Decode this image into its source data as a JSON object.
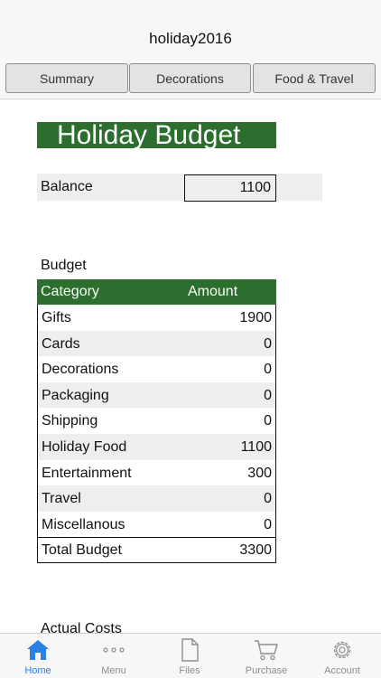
{
  "app": {
    "title": "holiday2016"
  },
  "tabs": [
    {
      "label": "Summary"
    },
    {
      "label": "Decorations"
    },
    {
      "label": "Food & Travel"
    }
  ],
  "sheet": {
    "title": "Holiday Budget",
    "balance": {
      "label": "Balance",
      "value": "1100"
    },
    "budget": {
      "section_label": "Budget",
      "headers": {
        "category": "Category",
        "amount": "Amount"
      },
      "rows": [
        {
          "category": "Gifts",
          "amount": "1900"
        },
        {
          "category": "Cards",
          "amount": "0"
        },
        {
          "category": "Decorations",
          "amount": "0"
        },
        {
          "category": "Packaging",
          "amount": "0"
        },
        {
          "category": "Shipping",
          "amount": "0"
        },
        {
          "category": "Holiday Food",
          "amount": "1100"
        },
        {
          "category": "Entertainment",
          "amount": "300"
        },
        {
          "category": "Travel",
          "amount": "0"
        },
        {
          "category": "Miscellanous",
          "amount": "0"
        }
      ],
      "total": {
        "label": "Total Budget",
        "value": "3300"
      }
    },
    "actual_costs_label": "Actual Costs"
  },
  "bottom_nav": [
    {
      "label": "Home",
      "icon": "home-icon",
      "active": true
    },
    {
      "label": "Menu",
      "icon": "more-dots-icon",
      "active": false
    },
    {
      "label": "Files",
      "icon": "file-icon",
      "active": false
    },
    {
      "label": "Purchase",
      "icon": "cart-icon",
      "active": false
    },
    {
      "label": "Account",
      "icon": "gear-icon",
      "active": false
    }
  ],
  "colors": {
    "header_green": "#2c6e2e",
    "active_blue": "#2b7fe6",
    "inactive_gray": "#8e8e93",
    "alt_row": "#eeeeee"
  }
}
